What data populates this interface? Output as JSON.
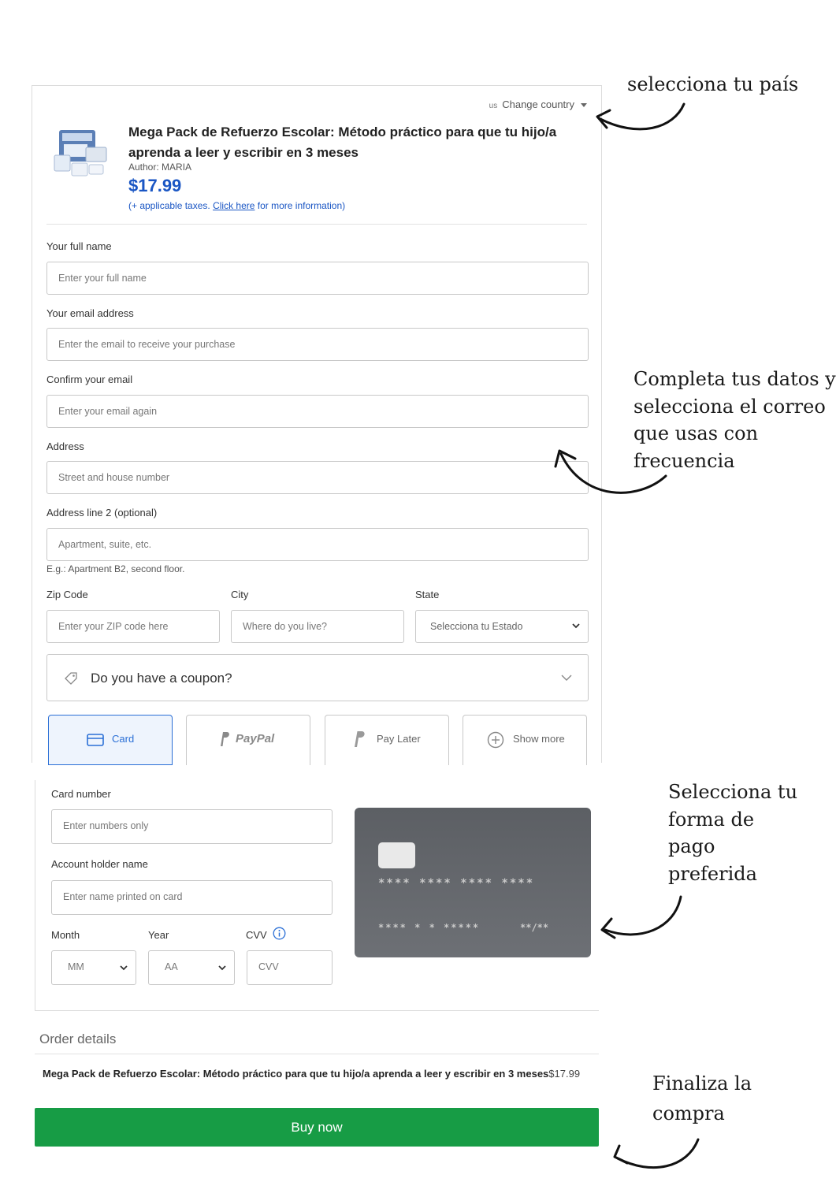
{
  "header": {
    "country_code": "us",
    "change_country": "Change country"
  },
  "product": {
    "title": "Mega Pack de Refuerzo Escolar: Método práctico para que tu hijo/a aprenda a leer y escribir en 3 meses",
    "author": "Author: MARIA",
    "price": "$17.99",
    "taxes_prefix": "(+ applicable taxes.",
    "taxes_link": "Click here",
    "taxes_suffix": "for more information)"
  },
  "form": {
    "full_name": {
      "label": "Your full name",
      "placeholder": "Enter your full name"
    },
    "email": {
      "label": "Your email address",
      "placeholder": "Enter the email to receive your purchase"
    },
    "confirm_email": {
      "label": "Confirm your email",
      "placeholder": "Enter your email again"
    },
    "address": {
      "label": "Address",
      "placeholder": "Street and house number"
    },
    "address2": {
      "label": "Address line 2 (optional)",
      "placeholder": "Apartment, suite, etc.",
      "hint": "E.g.: Apartment B2, second floor."
    },
    "zip": {
      "label": "Zip Code",
      "placeholder": "Enter your ZIP code here"
    },
    "city": {
      "label": "City",
      "placeholder": "Where do you live?"
    },
    "state": {
      "label": "State",
      "value": "Selecciona tu Estado"
    }
  },
  "coupon": {
    "label": "Do you have a coupon?"
  },
  "payment_methods": [
    {
      "label": "Card",
      "icon": "credit-card-icon",
      "active": true
    },
    {
      "label": "PayPal",
      "icon": "paypal-icon",
      "active": false
    },
    {
      "label": "Pay Later",
      "icon": "paypal-icon",
      "active": false
    },
    {
      "label": "Show more",
      "icon": "plus-circle-icon",
      "active": false
    }
  ],
  "card_form": {
    "card_number": {
      "label": "Card number",
      "placeholder": "Enter numbers only"
    },
    "holder": {
      "label": "Account holder name",
      "placeholder": "Enter name printed on card"
    },
    "month": {
      "label": "Month",
      "value": "MM"
    },
    "year": {
      "label": "Year",
      "value": "AA"
    },
    "cvv": {
      "label": "CVV",
      "placeholder": "CVV"
    }
  },
  "card_preview": {
    "number": "**** **** **** ****",
    "number2": "**** * * *****",
    "expiry": "**/**"
  },
  "order": {
    "title": "Order details",
    "item": "Mega Pack de Refuerzo Escolar: Método práctico para que tu hijo/a aprenda a leer y escribir en 3 meses",
    "item_price": "$17.99"
  },
  "buy_button": "Buy now",
  "annotations": {
    "country": "selecciona tu país",
    "data_lines": [
      "Completa tus datos y",
      "selecciona el correo",
      "que usas con",
      "frecuencia"
    ],
    "payment_lines": [
      "Selecciona tu",
      "forma de",
      "pago",
      "preferida"
    ],
    "finish_lines": [
      "Finaliza la",
      "compra"
    ]
  },
  "colors": {
    "accent": "#1a56c4",
    "buy": "#179c45",
    "active_border": "#2a6fd6"
  }
}
